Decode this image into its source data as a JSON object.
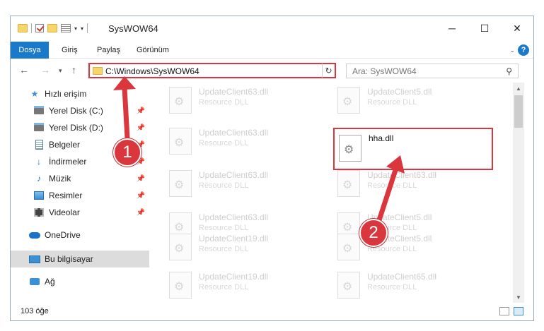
{
  "window": {
    "title": "SysWOW64",
    "controls": {
      "minimize": "─",
      "maximize": "☐",
      "close": "✕"
    }
  },
  "ribbon": {
    "file_tab": "Dosya",
    "tabs": [
      "Giriş",
      "Paylaş",
      "Görünüm"
    ],
    "help": "?"
  },
  "nav": {
    "address": "C:\\Windows\\SysWOW64",
    "search_placeholder": "Ara: SysWOW64"
  },
  "sidebar": {
    "items": [
      {
        "label": "Hızlı erişim",
        "icon": "star-icon"
      },
      {
        "label": "Yerel Disk (C:)",
        "icon": "drive-icon"
      },
      {
        "label": "Yerel Disk (D:)",
        "icon": "drive-icon"
      },
      {
        "label": "Belgeler",
        "icon": "document-icon"
      },
      {
        "label": "İndirmeler",
        "icon": "download-icon"
      },
      {
        "label": "Müzik",
        "icon": "music-icon"
      },
      {
        "label": "Resimler",
        "icon": "pictures-icon"
      },
      {
        "label": "Videolar",
        "icon": "videos-icon"
      },
      {
        "label": "OneDrive",
        "icon": "cloud-icon"
      },
      {
        "label": "Bu bilgisayar",
        "icon": "computer-icon"
      },
      {
        "label": "Ağ",
        "icon": "network-icon"
      }
    ]
  },
  "files": [
    {
      "name": "UpdateClient63.dll",
      "type": "Resource DLL"
    },
    {
      "name": "UpdateClient5.dll",
      "type": "Resource DLL"
    },
    {
      "name": "UpdateClient63.dll",
      "type": "Resource DLL"
    },
    {
      "name": "hha.dll",
      "type": ""
    },
    {
      "name": "UpdateClient63.dll",
      "type": "Resource DLL"
    },
    {
      "name": "UpdateClient63.dll",
      "type": "Resource DLL"
    },
    {
      "name": "UpdateClient63.dll",
      "type": "Resource DLL"
    },
    {
      "name": "UpdateClient5.dll",
      "type": "Resource DLL"
    },
    {
      "name": "UpdateClient19.dll",
      "type": "Resource DLL"
    },
    {
      "name": "UpdateClient5.dll",
      "type": "Resource DLL"
    },
    {
      "name": "UpdateClient19.dll",
      "type": "Resource DLL"
    },
    {
      "name": "UpdateClient65.dll",
      "type": "Resource DLL"
    }
  ],
  "status": {
    "count": "103 öğe"
  },
  "annotations": {
    "step1": "1",
    "step2": "2",
    "color": "#d9363e"
  }
}
